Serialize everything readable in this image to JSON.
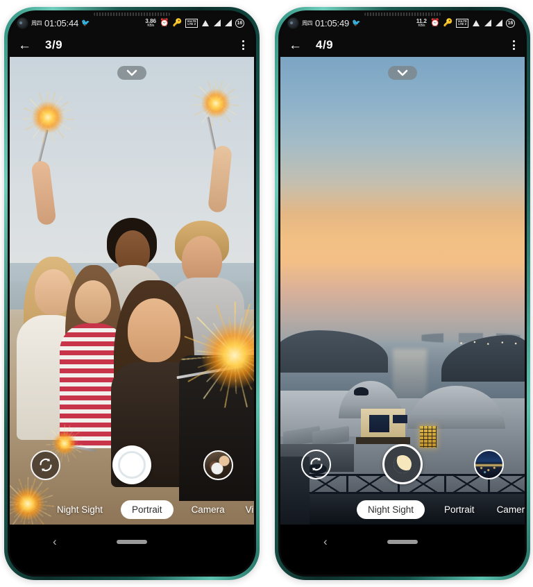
{
  "phones": [
    {
      "id": "phone-left",
      "status_bar": {
        "day": "周四",
        "time": "01:05:44",
        "notification_icon": "bird-notification-icon",
        "network_speed_value": "3.86",
        "network_speed_unit": "KB/s",
        "icons": [
          "alarm-icon",
          "key-icon",
          "volte-icon",
          "wifi-icon",
          "signal-icon",
          "signal-icon"
        ],
        "volte_top": "VoLTE",
        "volte_bottom": "LTE 2",
        "battery_level": "16"
      },
      "app_bar": {
        "back_icon": "back-arrow-icon",
        "title": "3/9",
        "overflow_icon": "more-options-icon"
      },
      "viewfinder": {
        "expand_icon": "chevron-down-icon",
        "scene_description": "beach group selfie with sparklers",
        "flip_icon": "camera-flip-icon",
        "shutter_icon": "shutter-button",
        "thumbnail_icon": "last-photo-thumbnail"
      },
      "modes": [
        {
          "label": "Night Sight",
          "active": false
        },
        {
          "label": "Portrait",
          "active": true
        },
        {
          "label": "Camera",
          "active": false
        },
        {
          "label": "Video",
          "active": false
        }
      ],
      "nav_bar": {
        "back_icon": "nav-back-icon",
        "home_icon": "nav-home-indicator"
      }
    },
    {
      "id": "phone-right",
      "status_bar": {
        "day": "周四",
        "time": "01:05:49",
        "notification_icon": "bird-notification-icon",
        "network_speed_value": "11.2",
        "network_speed_unit": "KB/s",
        "icons": [
          "alarm-icon",
          "key-icon",
          "volte-icon",
          "wifi-icon",
          "signal-icon",
          "signal-icon"
        ],
        "volte_top": "VoLTE",
        "volte_bottom": "LTE 2",
        "battery_level": "16"
      },
      "app_bar": {
        "back_icon": "back-arrow-icon",
        "title": "4/9",
        "overflow_icon": "more-options-icon"
      },
      "viewfinder": {
        "expand_icon": "chevron-down-icon",
        "scene_description": "Santorini sunset over the sea with white buildings",
        "flip_icon": "camera-flip-icon",
        "shutter_icon": "night-sight-moon-shutter",
        "thumbnail_icon": "last-photo-thumbnail"
      },
      "modes": [
        {
          "label": "Night Sight",
          "active": true
        },
        {
          "label": "Portrait",
          "active": false
        },
        {
          "label": "Camer",
          "active": false
        }
      ],
      "nav_bar": {
        "back_icon": "nav-back-icon",
        "home_icon": "nav-home-indicator"
      }
    }
  ],
  "colors": {
    "frame": "#2f8f7e",
    "status_bar_bg": "#0b0b0b",
    "active_mode_bg": "#ffffff",
    "active_mode_text": "#2c2c2c",
    "night_shutter_bg": "#3a3f45",
    "moon": "#f6e7bd"
  }
}
